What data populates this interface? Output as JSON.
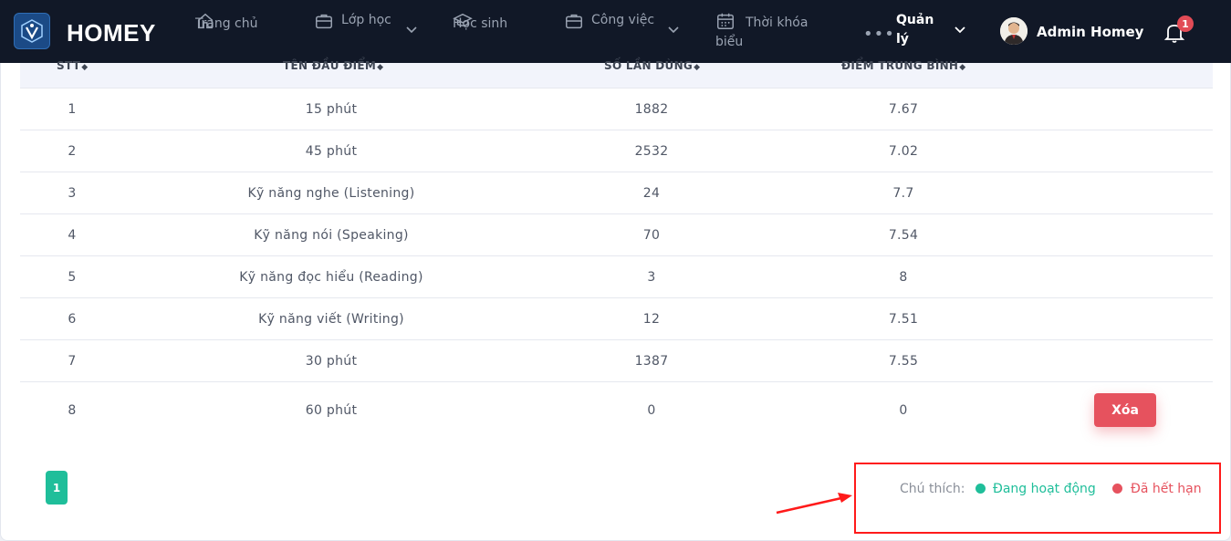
{
  "navbar": {
    "brand": "HOMEY",
    "items": [
      {
        "label": "Trang chủ",
        "icon": "home-icon"
      },
      {
        "label": "Lớp học",
        "icon": "briefcase-icon"
      },
      {
        "label": "Học sinh",
        "icon": "graduation-cap-icon"
      },
      {
        "label": "Công việc",
        "icon": "briefcase-icon"
      },
      {
        "label": "Thời khóa biểu",
        "icon": "calendar-icon"
      },
      {
        "label": "Quản lý",
        "icon": "more-icon"
      }
    ],
    "user_name": "Admin Homey",
    "notification_count": "1"
  },
  "table": {
    "columns": [
      "STT",
      "TÊN ĐẦU ĐIỂM",
      "SỐ LẦN DÙNG",
      "ĐIỂM TRUNG BÌNH"
    ],
    "rows": [
      {
        "stt": "1",
        "name": "15 phút",
        "uses": "1882",
        "avg": "7.67"
      },
      {
        "stt": "2",
        "name": "45 phút",
        "uses": "2532",
        "avg": "7.02"
      },
      {
        "stt": "3",
        "name": "Kỹ năng nghe (Listening)",
        "uses": "24",
        "avg": "7.7"
      },
      {
        "stt": "4",
        "name": "Kỹ năng nói (Speaking)",
        "uses": "70",
        "avg": "7.54"
      },
      {
        "stt": "5",
        "name": "Kỹ năng đọc hiểu (Reading)",
        "uses": "3",
        "avg": "8"
      },
      {
        "stt": "6",
        "name": "Kỹ năng viết (Writing)",
        "uses": "12",
        "avg": "7.51"
      },
      {
        "stt": "7",
        "name": "30 phút",
        "uses": "1387",
        "avg": "7.55"
      },
      {
        "stt": "8",
        "name": "60 phút",
        "uses": "0",
        "avg": "0",
        "action": "Xóa"
      }
    ]
  },
  "pagination": {
    "current": "1"
  },
  "legend": {
    "label": "Chú thích:",
    "active": "Đang hoạt động",
    "expired": "Đã hết hạn"
  },
  "colors": {
    "navbar_bg": "#111827",
    "active_green": "#1fbe9a",
    "expired_red": "#e6525e",
    "annotation_red": "#ff1a1a"
  }
}
